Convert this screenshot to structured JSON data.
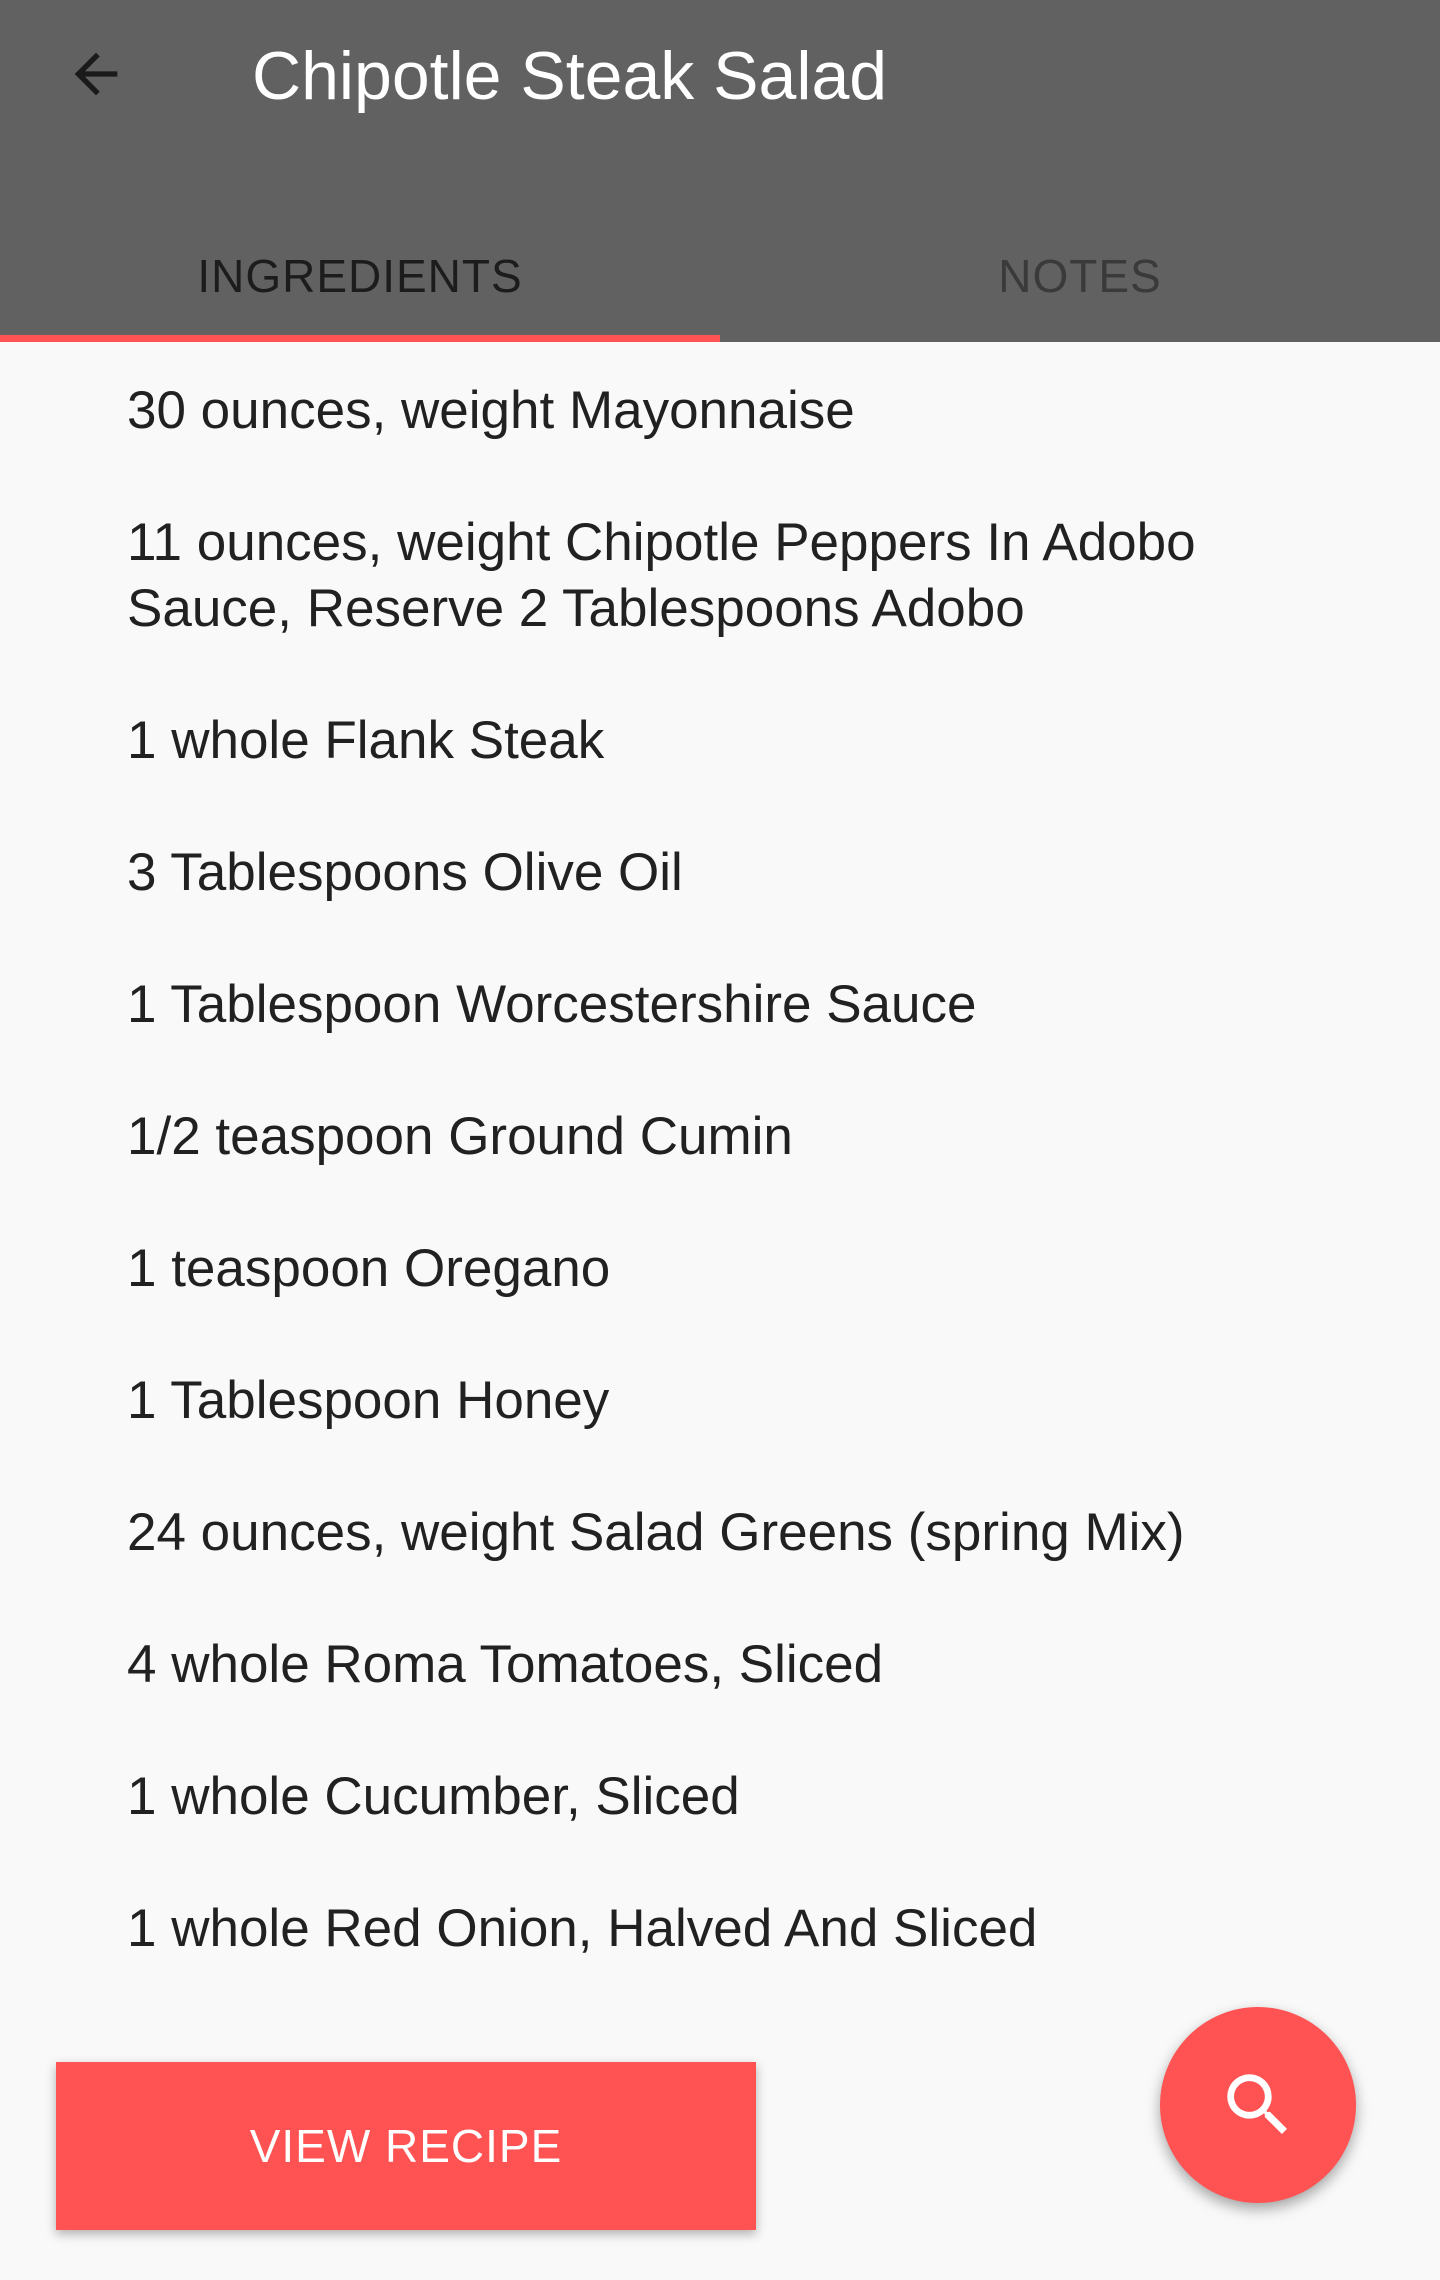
{
  "appbar": {
    "title": "Chipotle Steak Salad",
    "back_icon": "arrow-back-icon",
    "background_color": "#616161"
  },
  "tabs": [
    {
      "label": "INGREDIENTS",
      "active": true
    },
    {
      "label": "NOTES",
      "active": false
    }
  ],
  "accent_color": "#ff5252",
  "ingredients": [
    "30 ounces, weight Mayonnaise",
    "11 ounces, weight Chipotle Peppers In Adobo Sauce, Reserve 2 Tablespoons Adobo",
    "1 whole Flank Steak",
    "3 Tablespoons Olive Oil",
    "1 Tablespoon Worcestershire Sauce",
    "1/2 teaspoon Ground Cumin",
    "1 teaspoon Oregano",
    "1 Tablespoon Honey",
    "24 ounces, weight Salad Greens (spring Mix)",
    "4 whole Roma Tomatoes, Sliced",
    "1 whole Cucumber, Sliced",
    "1 whole Red Onion, Halved And Sliced"
  ],
  "view_recipe_button": {
    "label": "VIEW RECIPE"
  },
  "fab": {
    "icon": "search-icon"
  }
}
